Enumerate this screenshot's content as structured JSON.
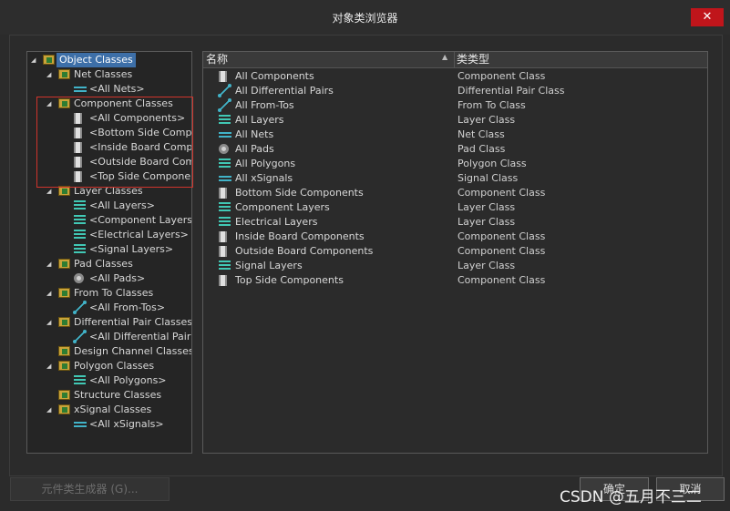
{
  "window": {
    "title": "对象类浏览器",
    "close_glyph": "✕"
  },
  "tree": {
    "items": [
      {
        "label": "Object Classes",
        "icon": "folder-icon",
        "level": 0,
        "expanded": true,
        "selected": true
      },
      {
        "label": "Net Classes",
        "icon": "folder-icon",
        "level": 1,
        "expanded": true
      },
      {
        "label": "<All Nets>",
        "icon": "net-icon",
        "level": 2
      },
      {
        "label": "Component Classes",
        "icon": "folder-icon",
        "level": 1,
        "expanded": true
      },
      {
        "label": "<All Components>",
        "icon": "component-icon",
        "level": 2
      },
      {
        "label": "<Bottom Side Compor",
        "icon": "component-icon",
        "level": 2
      },
      {
        "label": "<Inside Board Compo",
        "icon": "component-icon",
        "level": 2
      },
      {
        "label": "<Outside Board Comp",
        "icon": "component-icon",
        "level": 2
      },
      {
        "label": "<Top Side Componen",
        "icon": "component-icon",
        "level": 2
      },
      {
        "label": "Layer Classes",
        "icon": "folder-icon",
        "level": 1,
        "expanded": true
      },
      {
        "label": "<All Layers>",
        "icon": "layer-icon",
        "level": 2
      },
      {
        "label": "<Component Layers>",
        "icon": "layer-icon",
        "level": 2
      },
      {
        "label": "<Electrical Layers>",
        "icon": "layer-icon",
        "level": 2
      },
      {
        "label": "<Signal Layers>",
        "icon": "layer-icon",
        "level": 2
      },
      {
        "label": "Pad Classes",
        "icon": "folder-icon",
        "level": 1,
        "expanded": true
      },
      {
        "label": "<All Pads>",
        "icon": "pad-icon",
        "level": 2
      },
      {
        "label": "From To Classes",
        "icon": "folder-icon",
        "level": 1,
        "expanded": true
      },
      {
        "label": "<All From-Tos>",
        "icon": "from-to-icon",
        "level": 2
      },
      {
        "label": "Differential Pair Classes",
        "icon": "folder-icon",
        "level": 1,
        "expanded": true
      },
      {
        "label": "<All Differential Pairs>",
        "icon": "from-to-icon",
        "level": 2
      },
      {
        "label": "Design Channel Classes",
        "icon": "folder-icon",
        "level": 1
      },
      {
        "label": "Polygon Classes",
        "icon": "folder-icon",
        "level": 1,
        "expanded": true
      },
      {
        "label": "<All Polygons>",
        "icon": "layer-icon",
        "level": 2
      },
      {
        "label": "Structure Classes",
        "icon": "folder-icon",
        "level": 1
      },
      {
        "label": "xSignal Classes",
        "icon": "folder-icon",
        "level": 1,
        "expanded": true
      },
      {
        "label": "<All xSignals>",
        "icon": "net-icon",
        "level": 2
      }
    ]
  },
  "list": {
    "columns": {
      "name": "名称",
      "type": "类类型"
    },
    "rows": [
      {
        "name": "All Components",
        "type": "Component Class",
        "icon": "component-icon"
      },
      {
        "name": "All Differential Pairs",
        "type": "Differential Pair Class",
        "icon": "from-to-icon"
      },
      {
        "name": "All From-Tos",
        "type": "From To Class",
        "icon": "from-to-icon"
      },
      {
        "name": "All Layers",
        "type": "Layer Class",
        "icon": "layer-icon"
      },
      {
        "name": "All Nets",
        "type": "Net Class",
        "icon": "net-icon"
      },
      {
        "name": "All Pads",
        "type": "Pad Class",
        "icon": "pad-icon"
      },
      {
        "name": "All Polygons",
        "type": "Polygon Class",
        "icon": "layer-icon"
      },
      {
        "name": "All xSignals",
        "type": "Signal Class",
        "icon": "net-icon"
      },
      {
        "name": "Bottom Side Components",
        "type": "Component Class",
        "icon": "component-icon"
      },
      {
        "name": "Component Layers",
        "type": "Layer Class",
        "icon": "layer-icon"
      },
      {
        "name": "Electrical Layers",
        "type": "Layer Class",
        "icon": "layer-icon"
      },
      {
        "name": "Inside Board Components",
        "type": "Component Class",
        "icon": "component-icon"
      },
      {
        "name": "Outside Board Components",
        "type": "Component Class",
        "icon": "component-icon"
      },
      {
        "name": "Signal Layers",
        "type": "Layer Class",
        "icon": "layer-icon"
      },
      {
        "name": "Top Side Components",
        "type": "Component Class",
        "icon": "component-icon"
      }
    ]
  },
  "buttons": {
    "generator": "元件类生成器 (G)...",
    "ok": "确定",
    "cancel": "取消"
  },
  "watermark": "CSDN @五月不三二",
  "colors": {
    "selection": "#3d6fa8",
    "close": "#c0151b",
    "highlight_box": "#d0342c",
    "icon_accent": "#41b3c8"
  }
}
